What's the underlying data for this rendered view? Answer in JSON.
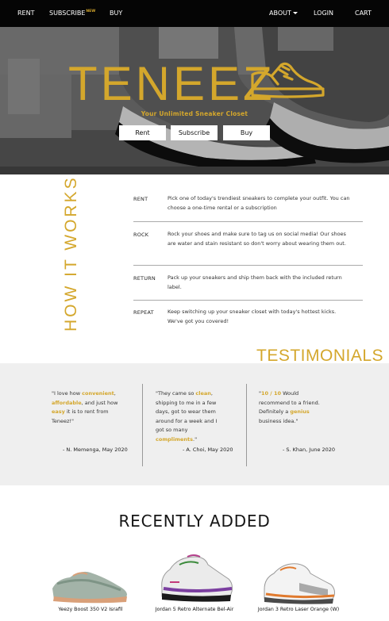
{
  "nav": {
    "rent": "RENT",
    "subscribe": "SUBSCRIBE",
    "subscribe_badge": "NEW",
    "buy": "BUY",
    "about": "ABOUT",
    "login": "LOGIN",
    "cart": "CART"
  },
  "hero": {
    "brand": "TENEEZ",
    "tagline": "Your Unlimited Sneaker Closet",
    "buttons": [
      "Rent",
      "Subscribe",
      "Buy"
    ]
  },
  "how_it_works": {
    "title": "HOW IT WORKS",
    "steps": [
      {
        "name": "RENT",
        "desc": "Pick one of today's trendiest sneakers to complete your outfit. You can choose a one-time rental or a subscription"
      },
      {
        "name": "ROCK",
        "desc": "Rock your shoes and make sure to tag us on social media! Our shoes are water and stain resistant so don't worry about wearing them out."
      },
      {
        "name": "RETURN",
        "desc": "Pack up your sneakers and ship them back with the included return label."
      },
      {
        "name": "REPEAT",
        "desc": "Keep switching up your sneaker closet with today's hottest kicks. We've got you covered!"
      }
    ]
  },
  "testimonials": {
    "title": "TESTIMONIALS",
    "items": [
      {
        "quote": [
          {
            "t": "\"I love how "
          },
          {
            "t": "convenient",
            "hl": true
          },
          {
            "t": ", "
          },
          {
            "t": "affordable",
            "hl": true
          },
          {
            "t": ", and just how "
          },
          {
            "t": "easy",
            "hl": true
          },
          {
            "t": " it is to rent from Teneez!\""
          }
        ],
        "author": "- N. Memenga, May 2020"
      },
      {
        "quote": [
          {
            "t": "\"They came so "
          },
          {
            "t": "clean",
            "hl": true
          },
          {
            "t": ", shipping to me in a few days, got to wear them around for a week and I got so many "
          },
          {
            "t": "compliments",
            "hl": true
          },
          {
            "t": ".\""
          }
        ],
        "author": "- A. Choi, May 2020"
      },
      {
        "quote": [
          {
            "t": "\""
          },
          {
            "t": "10 / 10",
            "hl": true
          },
          {
            "t": " Would recommend to a friend. Definitely a "
          },
          {
            "t": "genius",
            "hl": true
          },
          {
            "t": " business idea.\""
          }
        ],
        "author": "- S. Khan, June 2020"
      }
    ]
  },
  "recently_added": {
    "title": "RECENTLY ADDED",
    "items": [
      {
        "name": "Yeezy Boost 350 V2 Israfil"
      },
      {
        "name": "Jordan 5 Retro Alternate Bel-Air"
      },
      {
        "name": "Jordan 3 Retro Laser Orange (W)"
      }
    ]
  },
  "colors": {
    "accent": "#d4a72c",
    "nav_bg": "#050505",
    "band_bg": "#efefef"
  },
  "icons": {
    "logo": "sneaker-outline-icon",
    "about_dropdown": "caret-down-icon"
  }
}
